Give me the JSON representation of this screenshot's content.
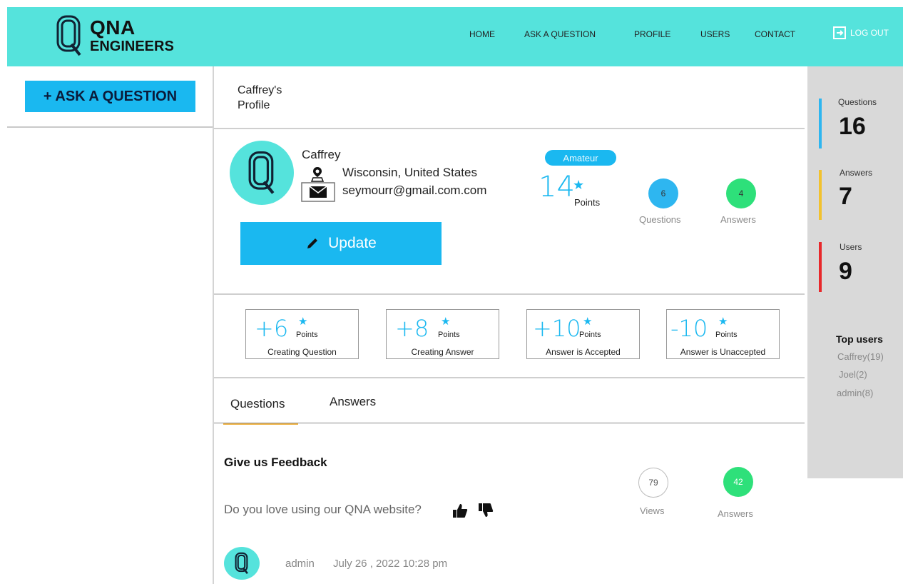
{
  "header": {
    "logo_line1": "QNA",
    "logo_line2": "ENGINEERS",
    "nav": [
      "HOME",
      "ASK A QUESTION",
      "PROFILE",
      "USERS",
      "CONTACT"
    ],
    "logout": "LOG OUT"
  },
  "sidebar": {
    "ask_button": "+ ASK A QUESTION"
  },
  "profile": {
    "page_title_line1": "Caffrey's",
    "page_title_line2": "Profile",
    "name": "Caffrey",
    "location": "Wisconsin, United States",
    "email": "seymourr@gmail.com.com",
    "update_button": "Update",
    "rank": "Amateur",
    "points": "14",
    "points_label": "Points",
    "questions_count": "6",
    "questions_label": "Questions",
    "answers_count": "4",
    "answers_label": "Answers"
  },
  "point_rules": [
    {
      "value": "+6",
      "unit": "Points",
      "caption": "Creating Question"
    },
    {
      "value": "+8",
      "unit": "Points",
      "caption": "Creating Answer"
    },
    {
      "value": "+10",
      "unit": "Points",
      "caption": "Answer is Accepted"
    },
    {
      "value": "-10",
      "unit": "Points",
      "caption": "Answer is Unaccepted"
    }
  ],
  "tabs": [
    "Questions",
    "Answers"
  ],
  "question": {
    "title": "Give us Feedback",
    "body": "Do you love using our QNA website?",
    "views": "79",
    "views_label": "Views",
    "answers": "42",
    "answers_label": "Answers",
    "author": "admin",
    "date": "July 26 , 2022 10:28 pm"
  },
  "stats": {
    "questions_label": "Questions",
    "questions_value": "16",
    "answers_label": "Answers",
    "answers_value": "7",
    "users_label": "Users",
    "users_value": "9",
    "colors": {
      "questions": "#2eb6f0",
      "answers": "#f2c22e",
      "users": "#e8282b"
    }
  },
  "top_users": {
    "title": "Top users",
    "items": [
      "Caffrey(19)",
      "Joel(2)",
      "admin(8)"
    ]
  },
  "colors": {
    "header": "#55e3dc",
    "accent": "#1ab8f0",
    "green": "#2ee07a",
    "tab_underline": "#f0b54a"
  }
}
